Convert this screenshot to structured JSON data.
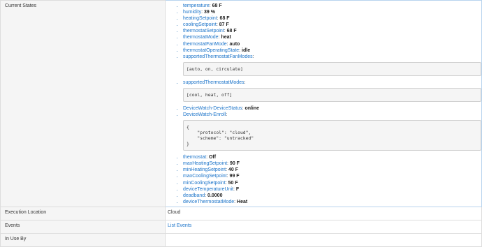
{
  "rows": {
    "current_states_label": "Current States",
    "execution_location_label": "Execution Location",
    "execution_location_value": "Cloud",
    "events_label": "Events",
    "events_link": "List Events",
    "in_use_by_label": "In Use By"
  },
  "attributes": [
    {
      "name": "temperature",
      "value": "68 F"
    },
    {
      "name": "humidity",
      "value": "39 %"
    },
    {
      "name": "heatingSetpoint",
      "value": "68 F"
    },
    {
      "name": "coolingSetpoint",
      "value": "87 F"
    },
    {
      "name": "thermostatSetpoint",
      "value": "68 F"
    },
    {
      "name": "thermostatMode",
      "value": "heat"
    },
    {
      "name": "thermostatFanMode",
      "value": "auto"
    },
    {
      "name": "thermostatOperatingState",
      "value": "idle"
    }
  ],
  "fan_modes": {
    "name": "supportedThermostatFanModes",
    "code": "[auto, on, circulate]"
  },
  "modes": {
    "name": "supportedThermostatModes",
    "code": "[cool, heat, off]"
  },
  "device_status": {
    "name": "DeviceWatch-DeviceStatus",
    "value": "online"
  },
  "enroll": {
    "name": "DeviceWatch-Enroll",
    "code": "{\n    \"protocol\": \"cloud\",\n    \"scheme\": \"untracked\"\n}"
  },
  "attributes2": [
    {
      "name": "thermostat",
      "value": "Off"
    },
    {
      "name": "maxHeatingSetpoint",
      "value": "90 F"
    },
    {
      "name": "minHeatingSetpoint",
      "value": "40 F"
    },
    {
      "name": "maxCoolingSetpoint",
      "value": "99 F"
    },
    {
      "name": "minCoolingSetpoint",
      "value": "50 F"
    },
    {
      "name": "deviceTemperatureUnit",
      "value": "F"
    },
    {
      "name": "deadband",
      "value": "0.0000"
    },
    {
      "name": "deviceThermostatMode",
      "value": "Heat"
    }
  ]
}
